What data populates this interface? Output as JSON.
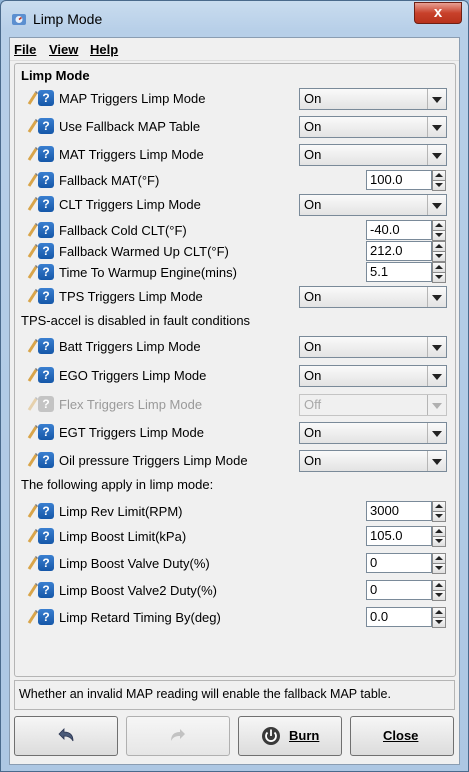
{
  "window": {
    "title": "Limp Mode",
    "close_label": "x"
  },
  "menu": {
    "file": "File",
    "view": "View",
    "help": "Help"
  },
  "panel": {
    "title": "Limp Mode"
  },
  "rows": [
    {
      "label": "MAP Triggers Limp Mode",
      "value": "On"
    },
    {
      "label": "Use Fallback MAP Table",
      "value": "On"
    },
    {
      "label": "MAT Triggers Limp Mode",
      "value": "On"
    },
    {
      "label": "Fallback MAT(°F)",
      "value": "100.0"
    },
    {
      "label": "CLT Triggers Limp Mode",
      "value": "On"
    },
    {
      "label": "Fallback Cold CLT(°F)",
      "value": "-40.0"
    },
    {
      "label": "Fallback Warmed Up CLT(°F)",
      "value": "212.0"
    },
    {
      "label": "Time To Warmup Engine(mins)",
      "value": "5.1"
    },
    {
      "label": "TPS Triggers Limp Mode",
      "value": "On"
    },
    {
      "label": "Batt Triggers Limp Mode",
      "value": "On"
    },
    {
      "label": "EGO Triggers Limp Mode",
      "value": "On"
    },
    {
      "label": "Flex Triggers Limp Mode",
      "value": "Off"
    },
    {
      "label": "EGT Triggers Limp Mode",
      "value": "On"
    },
    {
      "label": "Oil pressure Triggers Limp Mode",
      "value": "On"
    },
    {
      "label": "Limp Rev Limit(RPM)",
      "value": "3000"
    },
    {
      "label": "Limp Boost Limit(kPa)",
      "value": "105.0"
    },
    {
      "label": "Limp Boost Valve Duty(%)",
      "value": "0"
    },
    {
      "label": "Limp Boost Valve2 Duty(%)",
      "value": "0"
    },
    {
      "label": "Limp Retard Timing By(deg)",
      "value": "0.0"
    }
  ],
  "notes": {
    "tps_accel": "TPS-accel is disabled in fault conditions",
    "apply": "The following apply in limp mode:"
  },
  "status": "Whether an invalid MAP reading will enable the fallback MAP table.",
  "buttons": {
    "burn": "Burn",
    "close": "Close"
  },
  "colors": {
    "help_blue": "#1f6cc4",
    "titlebar": "#b9d1ea",
    "close_red": "#c8412b"
  }
}
